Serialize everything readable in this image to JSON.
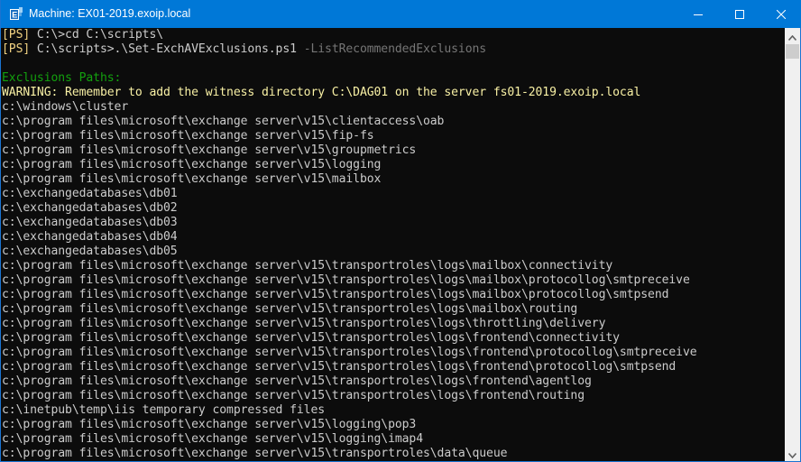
{
  "window": {
    "title": "Machine: EX01-2019.exoip.local",
    "icon": "exchange-management-shell-icon",
    "controls": {
      "minimize": "minimize-icon",
      "maximize": "maximize-icon",
      "close": "close-icon"
    }
  },
  "colors": {
    "titlebar": "#0078d7",
    "console_bg": "#0c0c0c",
    "text": "#cccccc",
    "prompt": "#f1d282",
    "parameter": "#767676",
    "section_header": "#13a10e",
    "warning": "#f9f1a5"
  },
  "console": {
    "commands": [
      {
        "prompt": "[PS]",
        "text": " C:\\>cd C:\\scripts\\",
        "param": ""
      },
      {
        "prompt": "[PS]",
        "text": " C:\\scripts>.\\Set-ExchAVExclusions.ps1 ",
        "param": "-ListRecommendedExclusions"
      }
    ],
    "section_header": "Exclusions Paths:",
    "warning": "WARNING: Remember to add the witness directory C:\\DAG01 on the server fs01-2019.exoip.local",
    "paths": [
      "c:\\windows\\cluster",
      "c:\\program files\\microsoft\\exchange server\\v15\\clientaccess\\oab",
      "c:\\program files\\microsoft\\exchange server\\v15\\fip-fs",
      "c:\\program files\\microsoft\\exchange server\\v15\\groupmetrics",
      "c:\\program files\\microsoft\\exchange server\\v15\\logging",
      "c:\\program files\\microsoft\\exchange server\\v15\\mailbox",
      "c:\\exchangedatabases\\db01",
      "c:\\exchangedatabases\\db02",
      "c:\\exchangedatabases\\db03",
      "c:\\exchangedatabases\\db04",
      "c:\\exchangedatabases\\db05",
      "c:\\program files\\microsoft\\exchange server\\v15\\transportroles\\logs\\mailbox\\connectivity",
      "c:\\program files\\microsoft\\exchange server\\v15\\transportroles\\logs\\mailbox\\protocollog\\smtpreceive",
      "c:\\program files\\microsoft\\exchange server\\v15\\transportroles\\logs\\mailbox\\protocollog\\smtpsend",
      "c:\\program files\\microsoft\\exchange server\\v15\\transportroles\\logs\\mailbox\\routing",
      "c:\\program files\\microsoft\\exchange server\\v15\\transportroles\\logs\\throttling\\delivery",
      "c:\\program files\\microsoft\\exchange server\\v15\\transportroles\\logs\\frontend\\connectivity",
      "c:\\program files\\microsoft\\exchange server\\v15\\transportroles\\logs\\frontend\\protocollog\\smtpreceive",
      "c:\\program files\\microsoft\\exchange server\\v15\\transportroles\\logs\\frontend\\protocollog\\smtpsend",
      "c:\\program files\\microsoft\\exchange server\\v15\\transportroles\\logs\\frontend\\agentlog",
      "c:\\program files\\microsoft\\exchange server\\v15\\transportroles\\logs\\frontend\\routing",
      "c:\\inetpub\\temp\\iis temporary compressed files",
      "c:\\program files\\microsoft\\exchange server\\v15\\logging\\pop3",
      "c:\\program files\\microsoft\\exchange server\\v15\\logging\\imap4",
      "c:\\program files\\microsoft\\exchange server\\v15\\transportroles\\data\\queue"
    ]
  },
  "scrollbar": {
    "position_fraction": 0.0
  }
}
